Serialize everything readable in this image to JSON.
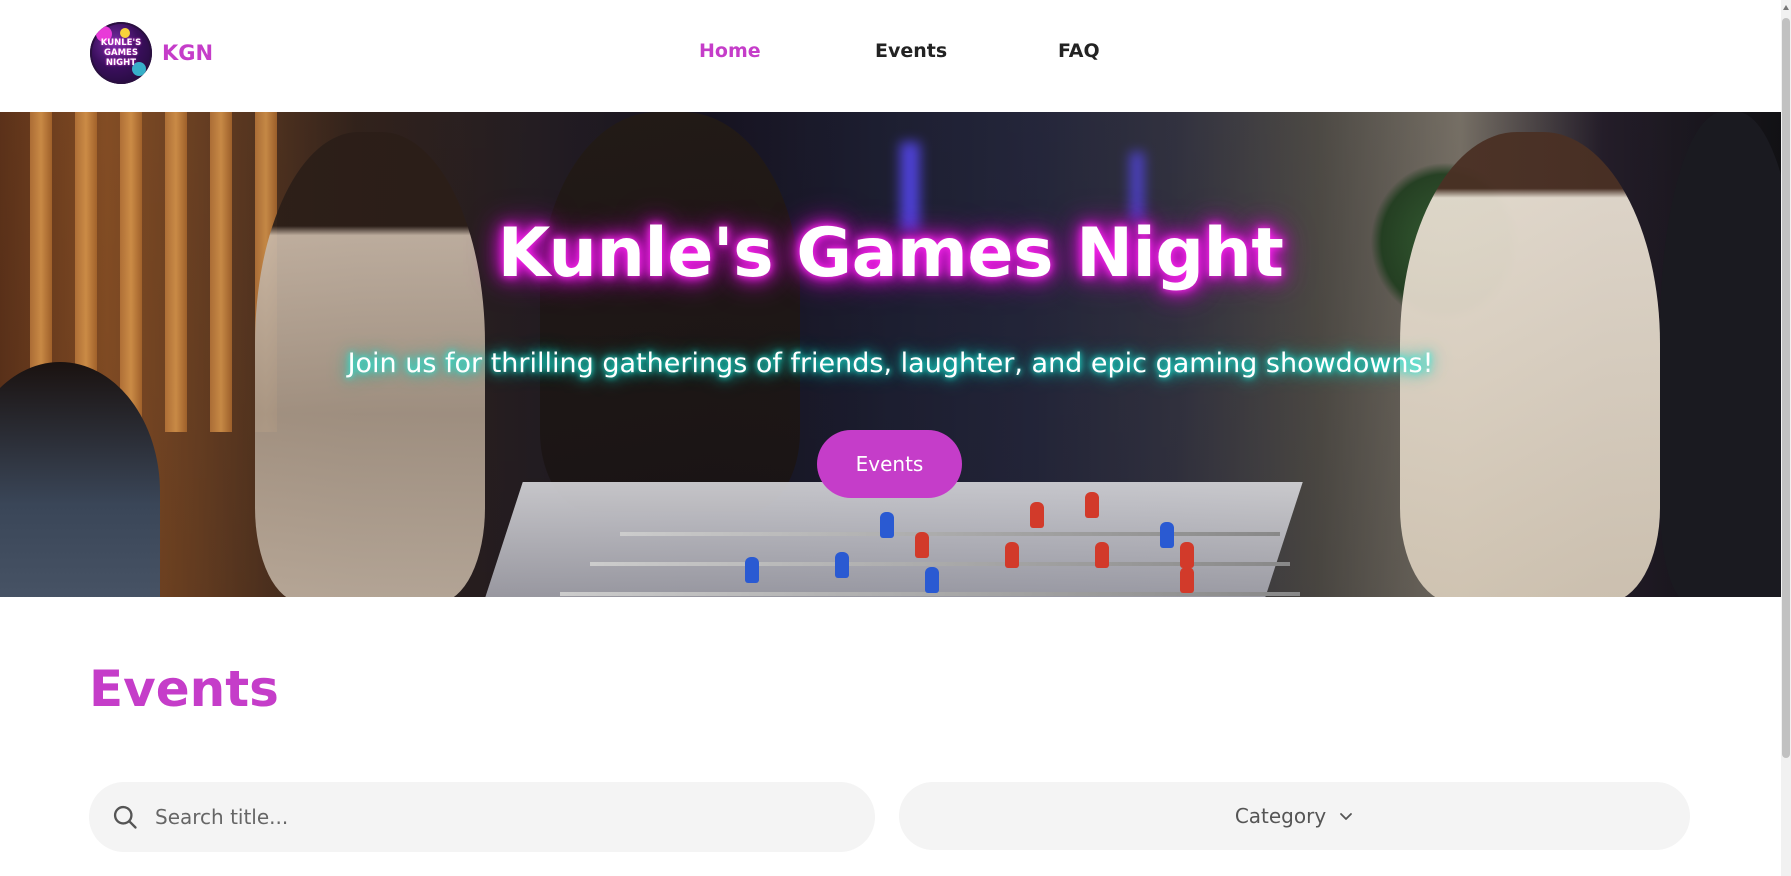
{
  "brand": {
    "logo_text": "KUNLE'S GAMES NIGHT",
    "name": "KGN"
  },
  "nav": {
    "items": [
      {
        "label": "Home",
        "active": true
      },
      {
        "label": "Events",
        "active": false
      },
      {
        "label": "FAQ",
        "active": false
      }
    ]
  },
  "hero": {
    "title": "Kunle's Games Night",
    "subtitle": "Join us for thrilling gatherings of friends, laughter, and epic gaming showdowns!",
    "button_label": "Events"
  },
  "events": {
    "title": "Events",
    "search_placeholder": "Search title...",
    "category_label": "Category"
  },
  "colors": {
    "accent": "#c53dc9",
    "title_glow": "#ff2af0",
    "subtitle_glow": "#1ff7e4",
    "field_bg": "#f4f4f4"
  },
  "icons": {
    "search": "search-icon",
    "category_dropdown": "chevron-down-icon"
  }
}
